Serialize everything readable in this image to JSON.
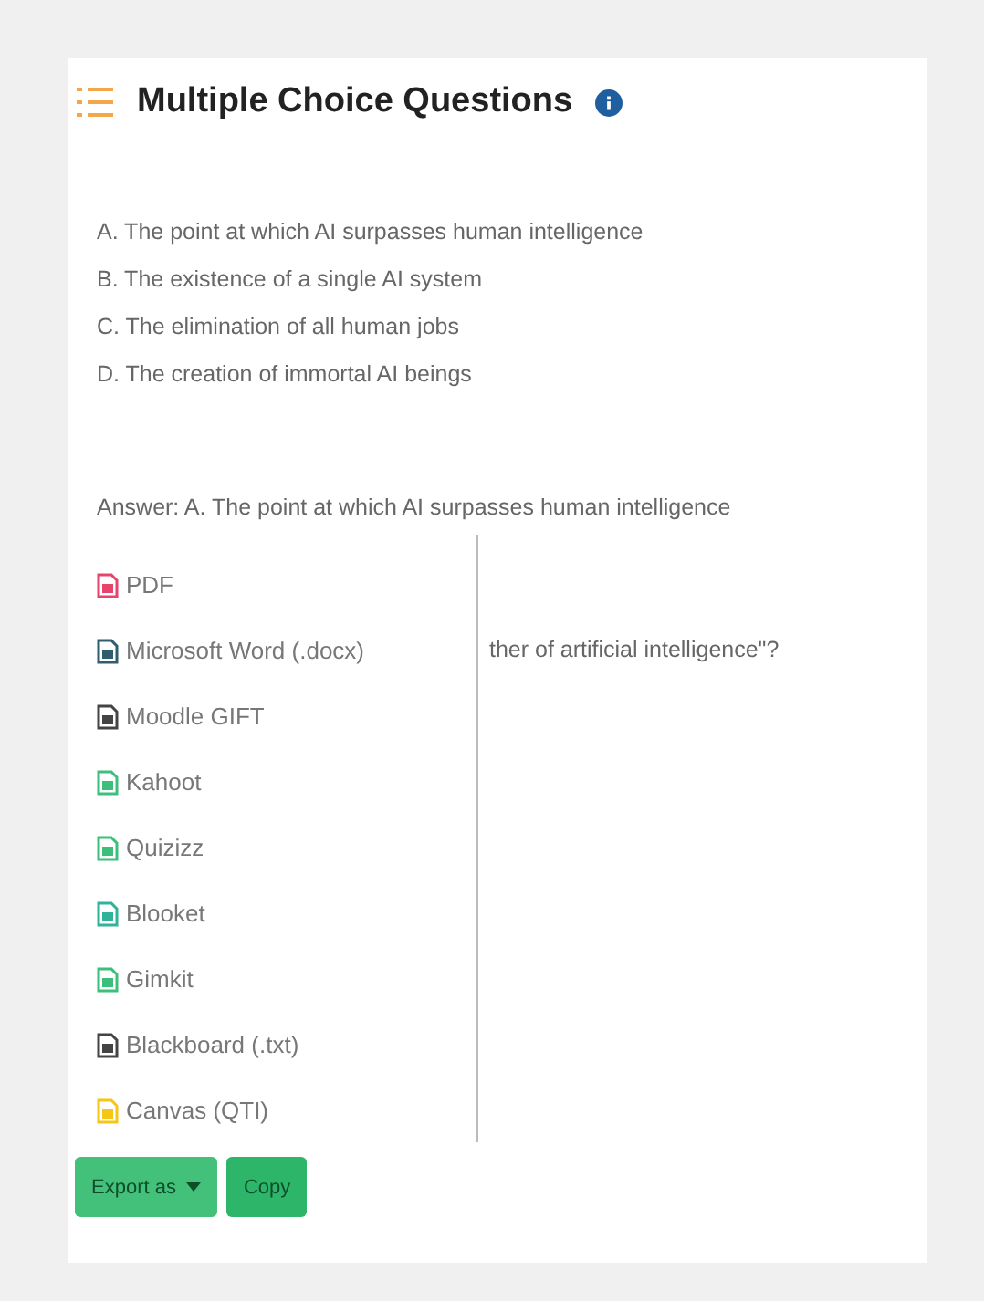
{
  "header": {
    "title": "Multiple Choice Questions"
  },
  "options": [
    "A. The point at which AI surpasses human intelligence",
    "B. The existence of a single AI system",
    "C. The elimination of all human jobs",
    "D. The creation of immortal AI beings"
  ],
  "answer": "Answer: A. The point at which AI surpasses human intelligence",
  "partial_question": "ther of artificial intelligence\"?",
  "export_menu": [
    {
      "label": "PDF",
      "color": "#e8436a"
    },
    {
      "label": "Microsoft Word (.docx)",
      "color": "#2f5f6f"
    },
    {
      "label": "Moodle GIFT",
      "color": "#444444"
    },
    {
      "label": "Kahoot",
      "color": "#3cbf7a"
    },
    {
      "label": "Quizizz",
      "color": "#3cbf7a"
    },
    {
      "label": "Blooket",
      "color": "#2fb39a"
    },
    {
      "label": "Gimkit",
      "color": "#3cbf7a"
    },
    {
      "label": "Blackboard (.txt)",
      "color": "#444444"
    },
    {
      "label": "Canvas (QTI)",
      "color": "#f5c518"
    }
  ],
  "buttons": [
    {
      "label": "Export as",
      "kind": "dropdown"
    },
    {
      "label": "Copy",
      "kind": "plain"
    }
  ]
}
